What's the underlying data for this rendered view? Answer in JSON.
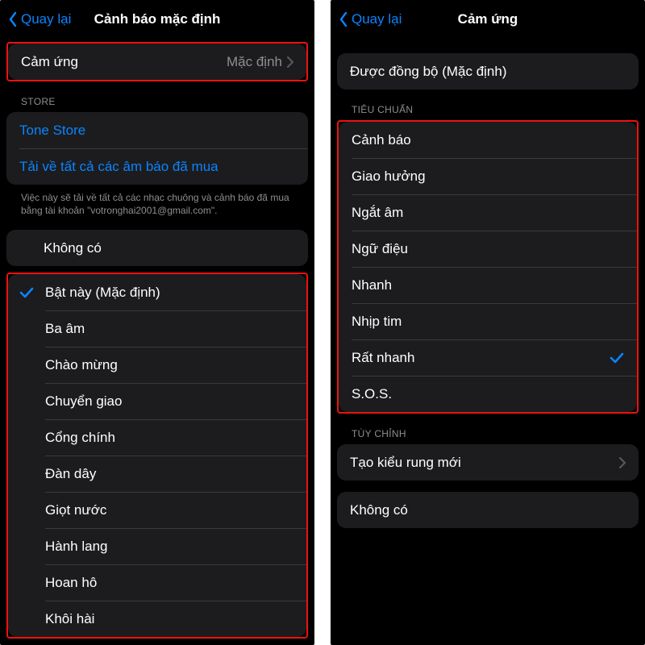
{
  "accent": "#0a84ff",
  "left": {
    "back": "Quay lại",
    "title": "Cảnh báo mặc định",
    "haptic_row": {
      "label": "Cảm ứng",
      "value": "Mặc định"
    },
    "store_header": "STORE",
    "store_items": [
      "Tone Store",
      "Tải về tất cả các âm báo đã mua"
    ],
    "store_footer": "Việc này sẽ tải về tất cả các nhạc chuông và cảnh báo đã mua bằng tài khoản \"votronghai2001@gmail.com\".",
    "none_label": "Không có",
    "tones": [
      "Bật này (Mặc định)",
      "Ba âm",
      "Chào mừng",
      "Chuyển giao",
      "Cổng chính",
      "Đàn dây",
      "Giọt nước",
      "Hành lang",
      "Hoan hô",
      "Khôi hài"
    ],
    "selected_index": 0
  },
  "right": {
    "back": "Quay lại",
    "title": "Cảm ứng",
    "synced_label": "Được đồng bộ (Mặc định)",
    "standard_header": "TIÊU CHUẨN",
    "standard_items": [
      "Cảnh báo",
      "Giao hưởng",
      "Ngắt âm",
      "Ngữ điệu",
      "Nhanh",
      "Nhịp tim",
      "Rất nhanh",
      "S.O.S."
    ],
    "standard_selected_index": 6,
    "custom_header": "TÙY CHỈNH",
    "custom_label": "Tạo kiểu rung mới",
    "none_label": "Không có"
  }
}
